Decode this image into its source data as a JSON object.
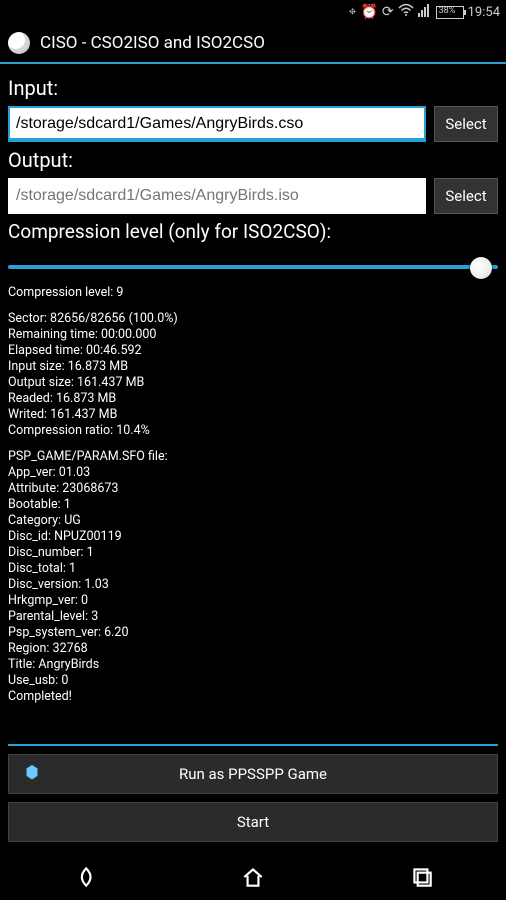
{
  "statusbar": {
    "battery_pct": "38%",
    "time": "19:54"
  },
  "titlebar": {
    "title": "CISO - CSO2ISO and ISO2CSO"
  },
  "input_section": {
    "label": "Input:",
    "value": "/storage/sdcard1/Games/AngryBirds.cso",
    "select_btn": "Select"
  },
  "output_section": {
    "label": "Output:",
    "placeholder": "/storage/sdcard1/Games/AngryBirds.iso",
    "select_btn": "Select"
  },
  "compression": {
    "label": "Compression level (only for ISO2CSO):",
    "level_text": "Compression level: 9"
  },
  "stats": {
    "lines1": [
      "Sector: 82656/82656 (100.0%)",
      "Remaining time: 00:00.000",
      "Elapsed time: 00:46.592",
      "Input size: 16.873 MB",
      "Output size: 161.437 MB",
      "Readed: 16.873 MB",
      "Writed: 161.437 MB",
      "Compression ratio: 10.4%"
    ],
    "lines2": [
      "PSP_GAME/PARAM.SFO file:",
      "App_ver: 01.03",
      "Attribute: 23068673",
      "Bootable: 1",
      "Category: UG",
      "Disc_id: NPUZ00119",
      "Disc_number: 1",
      "Disc_total: 1",
      "Disc_version: 1.03",
      "Hrkgmp_ver: 0",
      "Parental_level: 3",
      "Psp_system_ver: 6.20",
      "Region: 32768",
      "Title: AngryBirds",
      "Use_usb: 0",
      "Completed!"
    ]
  },
  "buttons": {
    "run_label": "Run as PPSSPP Game",
    "start_label": "Start"
  }
}
